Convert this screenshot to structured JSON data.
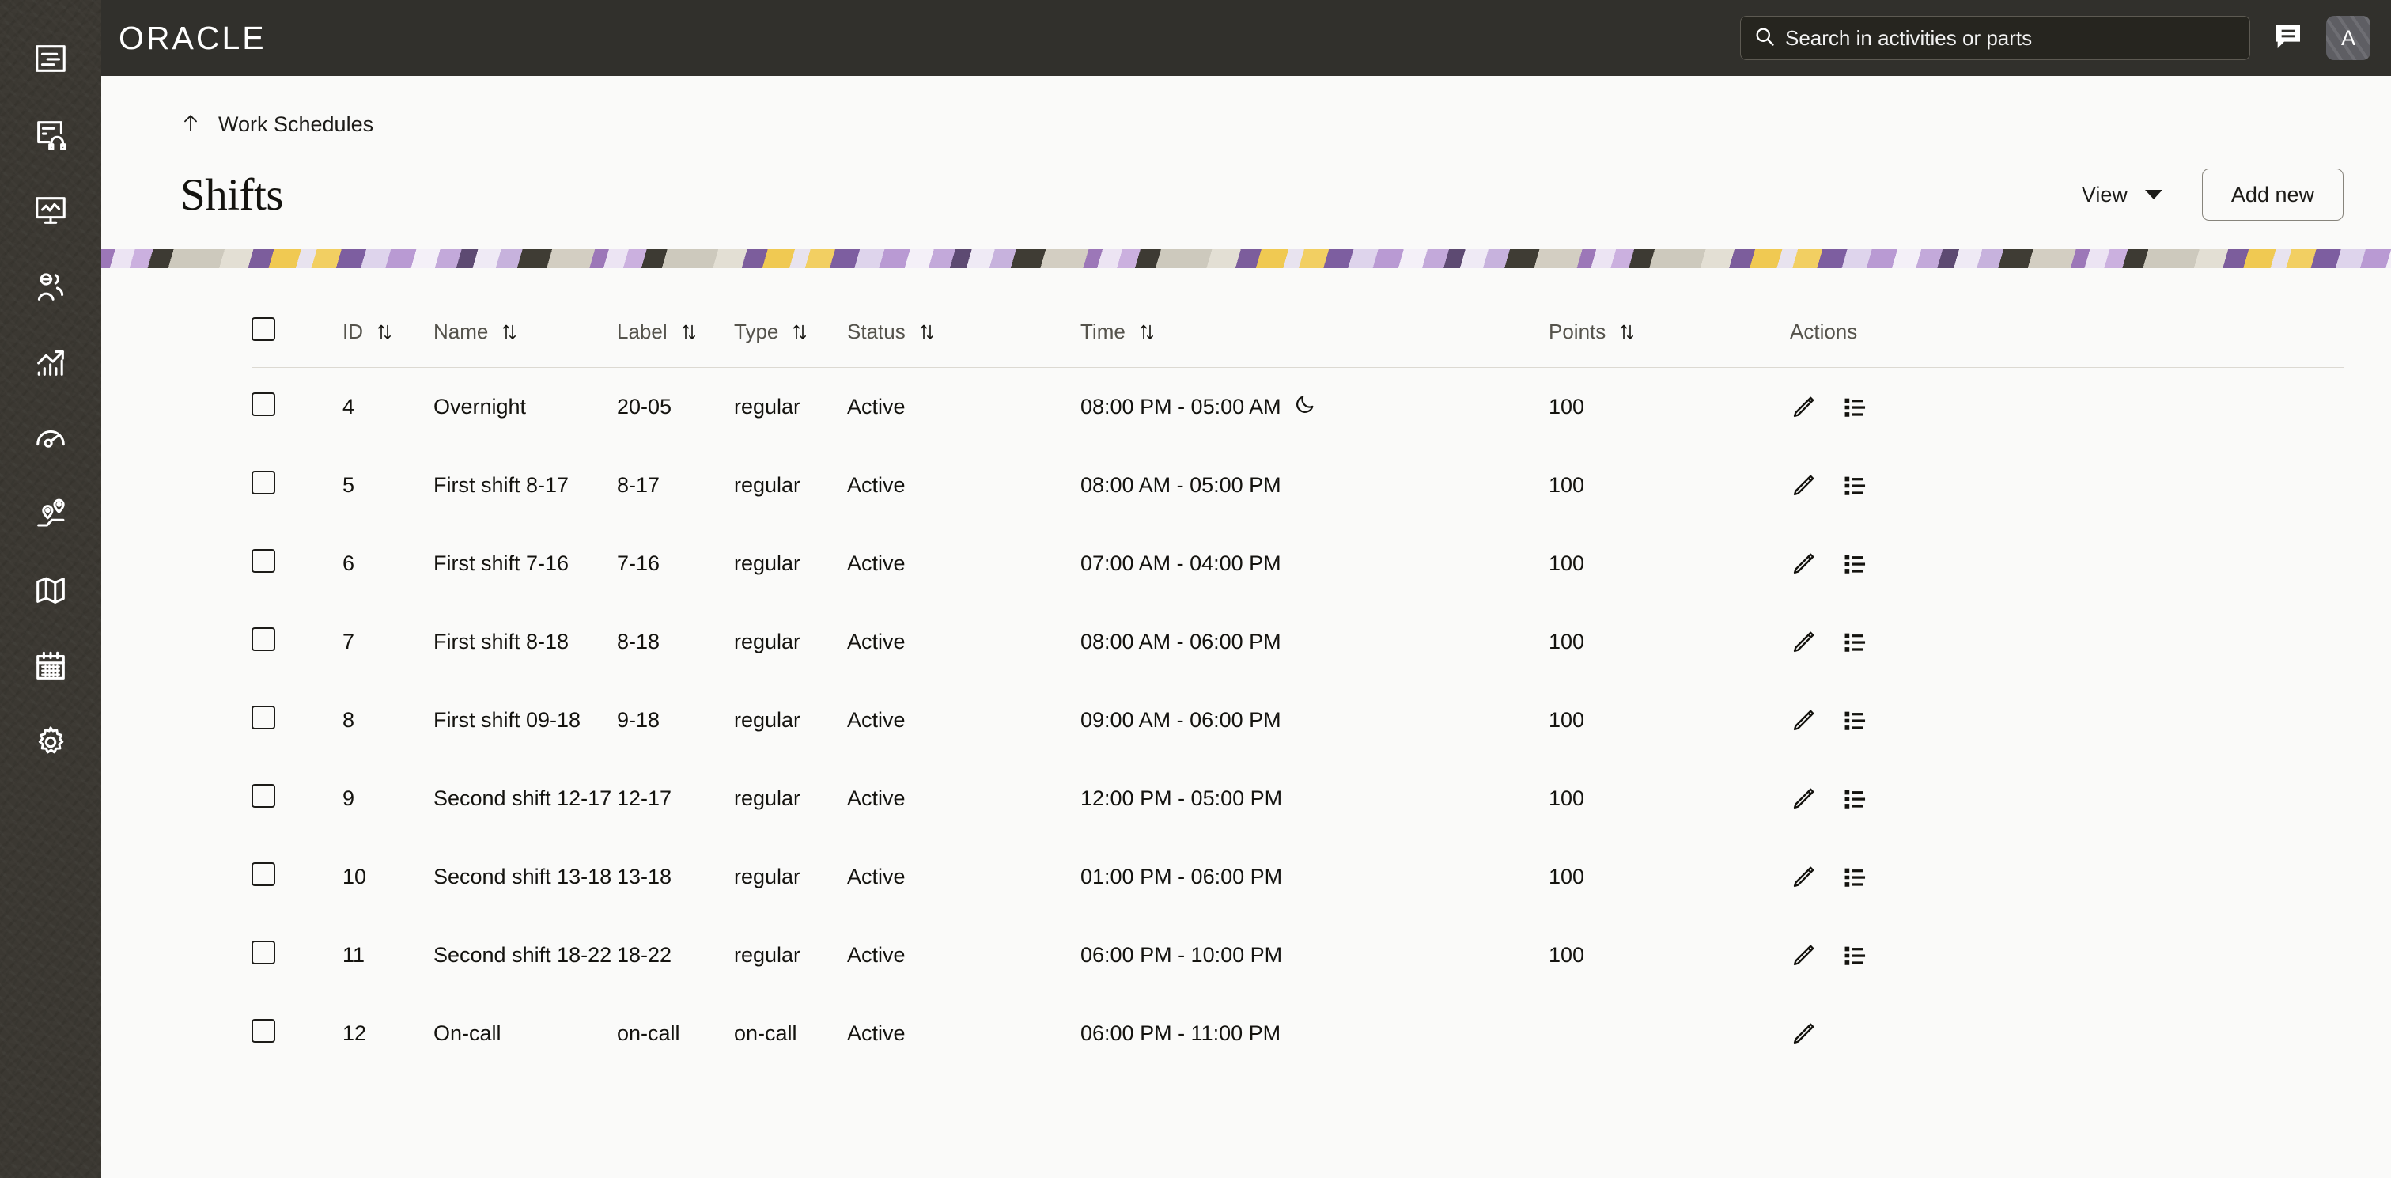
{
  "brand": {
    "logo_text": "ORACLE",
    "header_bg": "#31302c",
    "sidebar_bg": "#3b3832",
    "page_bg": "#fafaf9"
  },
  "topbar": {
    "search": {
      "value": "",
      "placeholder": "Search in activities or parts",
      "icon": "search-icon"
    },
    "messages_icon": "chat-bubble-icon",
    "avatar_initial": "A"
  },
  "sidebar": {
    "items": [
      {
        "icon": "dashboard-list-icon",
        "name": "dashboard"
      },
      {
        "icon": "document-headset-icon",
        "name": "support"
      },
      {
        "icon": "monitor-activity-icon",
        "name": "monitor"
      },
      {
        "icon": "users-icon",
        "name": "resources"
      },
      {
        "icon": "trending-bar-chart-icon",
        "name": "analytics"
      },
      {
        "icon": "gauge-icon",
        "name": "performance"
      },
      {
        "icon": "routing-pins-icon",
        "name": "routing"
      },
      {
        "icon": "map-icon",
        "name": "map"
      },
      {
        "icon": "calendar-icon",
        "name": "calendar"
      },
      {
        "icon": "gear-icon",
        "name": "configuration"
      }
    ]
  },
  "page": {
    "breadcrumb": {
      "label": "Work Schedules",
      "icon": "arrow-up-icon"
    },
    "title": "Shifts",
    "view_label": "View",
    "add_new_label": "Add new"
  },
  "table": {
    "columns": [
      {
        "key": "checkbox",
        "label": "",
        "sortable": false
      },
      {
        "key": "id",
        "label": "ID",
        "sortable": true
      },
      {
        "key": "name",
        "label": "Name",
        "sortable": true
      },
      {
        "key": "label",
        "label": "Label",
        "sortable": true
      },
      {
        "key": "type",
        "label": "Type",
        "sortable": true
      },
      {
        "key": "status",
        "label": "Status",
        "sortable": true
      },
      {
        "key": "time",
        "label": "Time",
        "sortable": true
      },
      {
        "key": "points",
        "label": "Points",
        "sortable": true
      },
      {
        "key": "actions",
        "label": "Actions",
        "sortable": false
      }
    ],
    "rows": [
      {
        "id": "4",
        "name": "Overnight",
        "label": "20-05",
        "type": "regular",
        "status": "Active",
        "time": "08:00 PM - 05:00 AM",
        "overnight": true,
        "points": "100",
        "actions": [
          "edit-pencil-icon",
          "list-detail-icon"
        ]
      },
      {
        "id": "5",
        "name": "First shift 8-17",
        "label": "8-17",
        "type": "regular",
        "status": "Active",
        "time": "08:00 AM - 05:00 PM",
        "overnight": false,
        "points": "100",
        "actions": [
          "edit-pencil-icon",
          "list-detail-icon"
        ]
      },
      {
        "id": "6",
        "name": "First shift 7-16",
        "label": "7-16",
        "type": "regular",
        "status": "Active",
        "time": "07:00 AM - 04:00 PM",
        "overnight": false,
        "points": "100",
        "actions": [
          "edit-pencil-icon",
          "list-detail-icon"
        ]
      },
      {
        "id": "7",
        "name": "First shift 8-18",
        "label": "8-18",
        "type": "regular",
        "status": "Active",
        "time": "08:00 AM - 06:00 PM",
        "overnight": false,
        "points": "100",
        "actions": [
          "edit-pencil-icon",
          "list-detail-icon"
        ]
      },
      {
        "id": "8",
        "name": "First shift 09-18",
        "label": "9-18",
        "type": "regular",
        "status": "Active",
        "time": "09:00 AM - 06:00 PM",
        "overnight": false,
        "points": "100",
        "actions": [
          "edit-pencil-icon",
          "list-detail-icon"
        ]
      },
      {
        "id": "9",
        "name": "Second shift 12-17",
        "label": "12-17",
        "type": "regular",
        "status": "Active",
        "time": "12:00 PM - 05:00 PM",
        "overnight": false,
        "points": "100",
        "actions": [
          "edit-pencil-icon",
          "list-detail-icon"
        ]
      },
      {
        "id": "10",
        "name": "Second shift 13-18",
        "label": "13-18",
        "type": "regular",
        "status": "Active",
        "time": "01:00 PM - 06:00 PM",
        "overnight": false,
        "points": "100",
        "actions": [
          "edit-pencil-icon",
          "list-detail-icon"
        ]
      },
      {
        "id": "11",
        "name": "Second shift 18-22",
        "label": "18-22",
        "type": "regular",
        "status": "Active",
        "time": "06:00 PM - 10:00 PM",
        "overnight": false,
        "points": "100",
        "actions": [
          "edit-pencil-icon",
          "list-detail-icon"
        ]
      },
      {
        "id": "12",
        "name": "On-call",
        "label": "on-call",
        "type": "on-call",
        "status": "Active",
        "time": "06:00 PM - 11:00 PM",
        "overnight": false,
        "points": "",
        "actions": [
          "edit-pencil-icon"
        ]
      }
    ]
  }
}
